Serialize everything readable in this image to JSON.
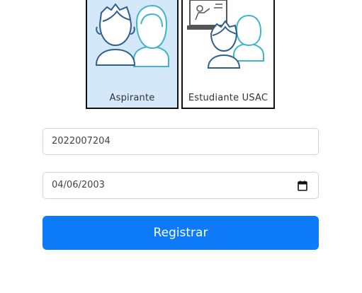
{
  "user_types": [
    {
      "label": "Aspirante",
      "icon": "people-icon",
      "selected": true
    },
    {
      "label": "Estudiante USAC",
      "icon": "presentation-people-icon",
      "selected": false
    }
  ],
  "form": {
    "carnet_value": "2022007204",
    "date_value": "04/06/2003",
    "submit_label": "Registrar"
  },
  "colors": {
    "selected_bg": "#d4e8fa",
    "primary": "#0d7bf7",
    "icon_dark": "#2d5f8f",
    "icon_light": "#3fb6cc"
  }
}
